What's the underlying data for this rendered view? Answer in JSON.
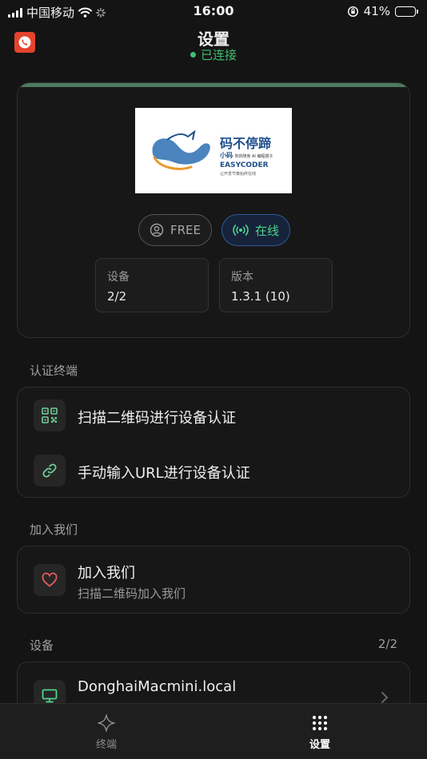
{
  "status_bar": {
    "carrier": "中国移动",
    "time": "16:00",
    "battery": "41%",
    "battery_level": 0.41
  },
  "header": {
    "title": "设置",
    "connection_status": "已连接"
  },
  "profile": {
    "free_label": "FREE",
    "online_label": "在线",
    "device_label": "设备",
    "device_value": "2/2",
    "version_label": "版本",
    "version_value": "1.3.1 (10)"
  },
  "logo": {
    "title": "码不停蹄",
    "sub1": "小码",
    "sub2": "- 你的随身 AI 编程搭子",
    "brand": "EASYCODER",
    "tagline": "让开发节奏始终在线"
  },
  "auth": {
    "section": "认证终端",
    "scan_label": "扫描二维码进行设备认证",
    "url_label": "手动输入URL进行设备认证"
  },
  "join": {
    "section": "加入我们",
    "title": "加入我们",
    "subtitle": "扫描二维码加入我们"
  },
  "devices": {
    "section": "设备",
    "count": "2/2",
    "items": [
      {
        "name": "DonghaiMacmini.local"
      }
    ]
  },
  "tabs": {
    "terminal": "终端",
    "settings": "设置"
  },
  "colors": {
    "accent_green": "#3fbf6f",
    "online_border": "#2f5a9a",
    "app_icon": "#e5432d"
  }
}
